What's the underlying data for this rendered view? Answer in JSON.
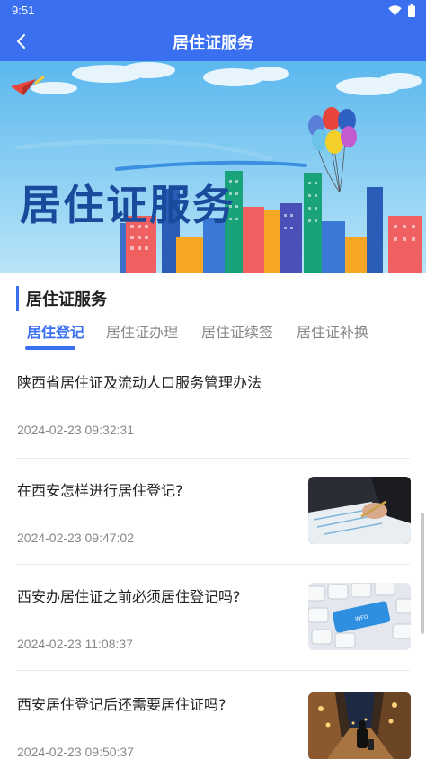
{
  "status_bar": {
    "time": "9:51"
  },
  "app_bar": {
    "title": "居住证服务"
  },
  "banner": {
    "headline": "居住证服务"
  },
  "section": {
    "title": "居住证服务"
  },
  "tabs": [
    {
      "label": "居住登记",
      "active": true
    },
    {
      "label": "居住证办理",
      "active": false
    },
    {
      "label": "居住证续签",
      "active": false
    },
    {
      "label": "居住证补换",
      "active": false
    }
  ],
  "articles": [
    {
      "title": "陕西省居住证及流动人口服务管理办法",
      "date": "2024-02-23 09:32:31",
      "thumbnail": null
    },
    {
      "title": "在西安怎样进行居住登记?",
      "date": "2024-02-23 09:47:02",
      "thumbnail": "signing-document-photo"
    },
    {
      "title": "西安办居住证之前必须居住登记吗?",
      "date": "2024-02-23 11:08:37",
      "thumbnail": "keyboard-key-photo"
    },
    {
      "title": "西安居住登记后还需要居住证吗?",
      "date": "2024-02-23 09:50:37",
      "thumbnail": "street-traveler-photo"
    }
  ],
  "colors": {
    "primary": "#3a6ff0",
    "text": "#222222",
    "muted": "#888888"
  },
  "icons": [
    "wifi-icon",
    "battery-icon",
    "back-arrow-icon",
    "paper-plane-icon",
    "balloons-icon"
  ]
}
